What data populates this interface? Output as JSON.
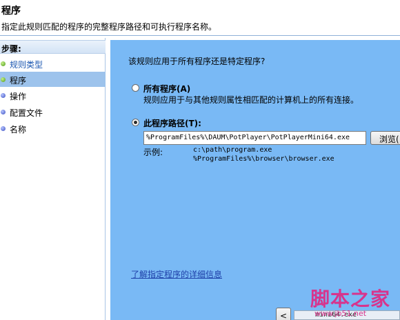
{
  "header": {
    "title": "程序",
    "description": "指定此规则匹配的程序的完整程序路径和可执行程序名称。"
  },
  "sidebar": {
    "heading": "步骤:",
    "steps": [
      {
        "label": "规则类型",
        "state": "done"
      },
      {
        "label": "程序",
        "state": "current"
      },
      {
        "label": "操作",
        "state": "pending"
      },
      {
        "label": "配置文件",
        "state": "pending"
      },
      {
        "label": "名称",
        "state": "pending"
      }
    ]
  },
  "main": {
    "question": "该规则应用于所有程序还是特定程序?",
    "all_programs": {
      "label": "所有程序(A)",
      "description": "规则应用于与其他规则属性相匹配的计算机上的所有连接。",
      "selected": false
    },
    "this_program": {
      "label": "此程序路径(T):",
      "selected": true
    },
    "path_value": "%ProgramFiles%\\DAUM\\PotPlayer\\PotPlayerMini64.exe",
    "browse_label": "浏览(",
    "example_label": "示例:",
    "examples": [
      "c:\\path\\program.exe",
      "%ProgramFiles%\\browser\\browser.exe"
    ],
    "learn_more_link": "了解指定程序的详细信息",
    "back_label": "<",
    "partial_text": "mini64.exe"
  },
  "watermark": {
    "logo": "脚本之家",
    "url": "www.jb51.net"
  },
  "colors": {
    "main_bg": "#79b9f5",
    "active_step_bg": "#9dc3ec",
    "link": "#1d3fa8",
    "watermark": "#d8348c"
  }
}
